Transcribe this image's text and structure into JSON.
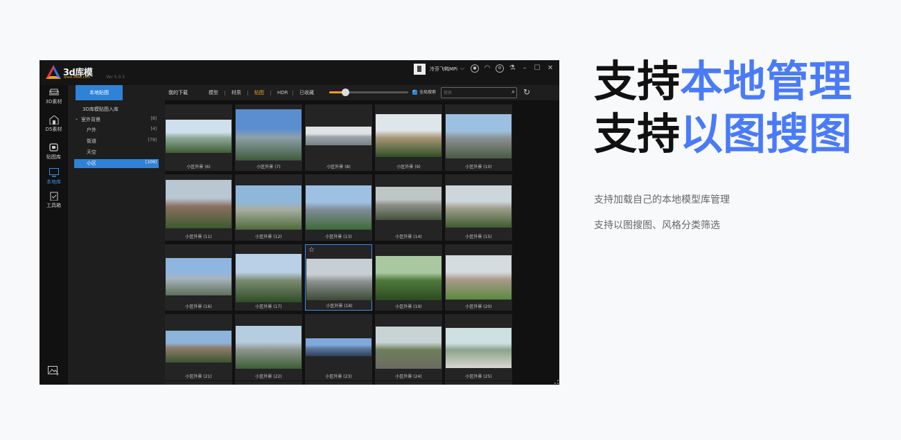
{
  "app": {
    "brand": "3d库模",
    "brand_url": "www.3d88.com",
    "version": "Ver 5.0.3",
    "username": "冷芬飞鸭MPi"
  },
  "leftnav": [
    {
      "label": "3D素材",
      "icon": "sofa-icon",
      "active": false
    },
    {
      "label": "D5素材",
      "icon": "building-icon",
      "active": false
    },
    {
      "label": "贴图库",
      "icon": "image-stack-icon",
      "active": false
    },
    {
      "label": "本地库",
      "icon": "monitor-icon",
      "active": true
    },
    {
      "label": "工具箱",
      "icon": "clipboard-icon",
      "active": false
    }
  ],
  "tabs": {
    "local": "本地贴图",
    "mydownloads": "我的下载"
  },
  "categories": [
    "模型",
    "材质",
    "贴图",
    "HDR",
    "已收藏"
  ],
  "active_category": "贴图",
  "zoom_level": 0.2,
  "fullsearch_label": "全局搜索",
  "search": {
    "placeholder": "搜索",
    "value": ""
  },
  "tree": {
    "import_label": "3D库模贴图入库",
    "group": {
      "label": "室外背景",
      "count": "[8]"
    },
    "items": [
      {
        "label": "户外",
        "count": "[4]",
        "active": false
      },
      {
        "label": "街道",
        "count": "[79]",
        "active": false
      },
      {
        "label": "天空",
        "count": "",
        "active": false
      },
      {
        "label": "小区",
        "count": "[109]",
        "active": true
      }
    ]
  },
  "grid": {
    "items": [
      "小区外景 (6)",
      "小区外景 (7)",
      "小区外景 (8)",
      "小区外景 (9)",
      "小区外景 (10)",
      "小区外景 (11)",
      "小区外景 (12)",
      "小区外景 (13)",
      "小区外景 (14)",
      "小区外景 (15)",
      "小区外景 (16)",
      "小区外景 (17)",
      "小区外景 (18)",
      "小区外景 (19)",
      "小区外景 (20)",
      "小区外景 (21)",
      "小区外景 (22)",
      "小区外景 (23)",
      "小区外景 (24)",
      "小区外景 (25)"
    ],
    "selected_index": 12
  },
  "marketing": {
    "line1_dark": "支持",
    "line1_blue": "本地管理",
    "line2_dark": "支持",
    "line2_blue": "以图搜图",
    "desc1": "支持加载自己的本地模型库管理",
    "desc2": "支持以图搜图、风格分类筛选"
  },
  "colors": {
    "accent_blue": "#2f82d6",
    "active_orange": "#f0a020",
    "headline_blue": "#4a7bf7"
  }
}
